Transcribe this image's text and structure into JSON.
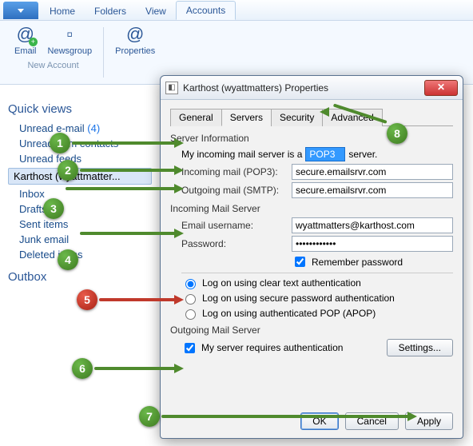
{
  "ribbon": {
    "tabs": [
      "Home",
      "Folders",
      "View",
      "Accounts"
    ],
    "active_tab": "Accounts",
    "email": "Email",
    "newsgroup": "Newsgroup",
    "properties": "Properties",
    "group": "New Account"
  },
  "nav": {
    "quick_views": "Quick views",
    "unread_email": "Unread e-mail",
    "unread_email_count": "(4)",
    "unread_from_contacts": "Unread from contacts",
    "unread_feeds": "Unread feeds",
    "account_name": "Karthost (wyattmatter...",
    "inbox": "Inbox",
    "drafts": "Drafts",
    "sent": "Sent items",
    "junk": "Junk email",
    "deleted": "Deleted items",
    "outbox": "Outbox"
  },
  "dialog": {
    "title": "Karthost (wyattmatters) Properties",
    "tabs": {
      "general": "General",
      "servers": "Servers",
      "security": "Security",
      "advanced": "Advanced"
    },
    "server_info": "Server Information",
    "my_incoming_is": "My incoming mail server is a",
    "server_type": "POP3",
    "server_suffix": "server.",
    "incoming_label": "Incoming mail (POP3):",
    "incoming_value": "secure.emailsrvr.com",
    "outgoing_label": "Outgoing mail (SMTP):",
    "outgoing_value": "secure.emailsrvr.com",
    "incoming_ms": "Incoming Mail Server",
    "user_label": "Email username:",
    "user_value": "wyattmatters@karthost.com",
    "pass_label": "Password:",
    "pass_value": "●●●●●●●●●●●●",
    "remember": "Remember password",
    "auth_clear": "Log on using clear text authentication",
    "auth_spa": "Log on using secure password authentication",
    "auth_apop": "Log on using authenticated POP (APOP)",
    "outgoing_ms": "Outgoing Mail Server",
    "req_auth": "My server requires authentication",
    "settings": "Settings...",
    "ok": "OK",
    "cancel": "Cancel",
    "apply": "Apply"
  },
  "annotations": {
    "n1": "1",
    "n2": "2",
    "n3": "3",
    "n4": "4",
    "n5": "5",
    "n6": "6",
    "n7": "7",
    "n8": "8"
  }
}
